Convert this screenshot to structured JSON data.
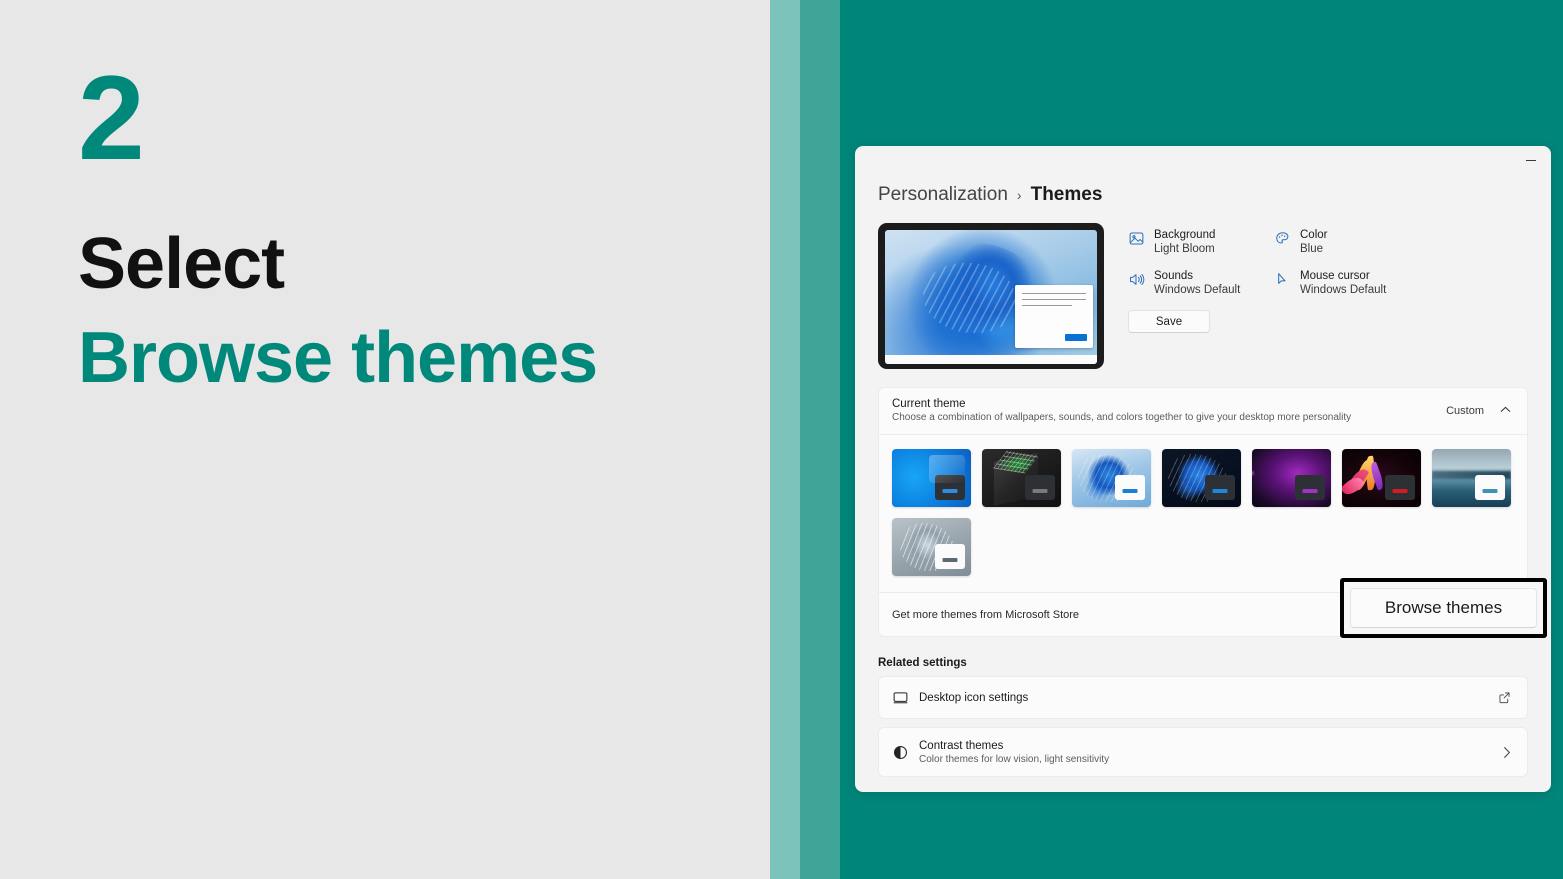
{
  "left": {
    "step_number": "2",
    "heading_line1": "Select",
    "heading_line2": "Browse themes",
    "accent_color": "#00897b",
    "background_color": "#e7e7e7"
  },
  "stripes": {
    "colors": [
      "#7cc3bb",
      "#3da497",
      "#00857a"
    ]
  },
  "window": {
    "minimize_label": "—",
    "breadcrumb": {
      "parent": "Personalization",
      "separator": "›",
      "current": "Themes"
    },
    "preview": {
      "info_items": [
        {
          "icon": "image-icon",
          "title": "Background",
          "value": "Light Bloom"
        },
        {
          "icon": "speaker-icon",
          "title": "Sounds",
          "value": "Windows Default"
        },
        {
          "icon": "palette-icon",
          "title": "Color",
          "value": "Blue"
        },
        {
          "icon": "cursor-icon",
          "title": "Mouse cursor",
          "value": "Windows Default"
        }
      ],
      "save_label": "Save"
    },
    "current_theme": {
      "title": "Current theme",
      "subtitle": "Choose a combination of wallpapers, sounds, and colors together to give your desktop more personality",
      "selected_value": "Custom",
      "chevron": "⌃",
      "themes": [
        {
          "name": "windows-light-blue",
          "style": "tb-1",
          "win": "tw-dark",
          "bar": "#2f8de0"
        },
        {
          "name": "xbox-dark",
          "style": "tb-2",
          "win": "tw-dark",
          "bar": "#7a7a7a"
        },
        {
          "name": "windows-light-bloom",
          "style": "tb-3",
          "win": "tw-light",
          "bar": "#1a7fd4"
        },
        {
          "name": "windows-dark-bloom",
          "style": "tb-4",
          "win": "tw-dark",
          "bar": "#1d86e0"
        },
        {
          "name": "glow-purple",
          "style": "tb-5",
          "win": "tw-dark",
          "bar": "#a430c8"
        },
        {
          "name": "flow-flower",
          "style": "tb-6",
          "win": "tw-dark",
          "bar": "#d01c22"
        },
        {
          "name": "sunrise-lake",
          "style": "tb-7",
          "win": "tw-light",
          "bar": "#3e93b4"
        },
        {
          "name": "captured-motion-gray",
          "style": "tb-8",
          "win": "tw-light",
          "bar": "#5e6a72"
        }
      ],
      "store_label": "Get more themes from Microsoft Store",
      "browse_label": "Browse themes"
    },
    "related_settings": {
      "title": "Related settings",
      "rows": [
        {
          "icon": "monitor-icon",
          "label": "Desktop icon settings",
          "sub": "",
          "trailing": "external-link-icon"
        },
        {
          "icon": "contrast-icon",
          "label": "Contrast themes",
          "sub": "Color themes for low vision, light sensitivity",
          "trailing": "chevron-right-icon"
        }
      ]
    }
  }
}
